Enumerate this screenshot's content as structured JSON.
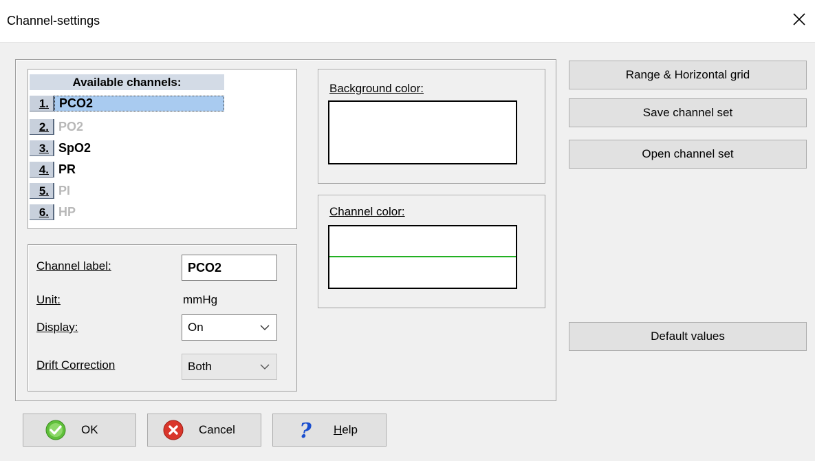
{
  "window": {
    "title": "Channel-settings"
  },
  "channels": {
    "header": "Available channels:",
    "items": [
      {
        "num": "1.",
        "name": "PCO2",
        "state": "selected"
      },
      {
        "num": "2.",
        "name": "PO2",
        "state": "disabled"
      },
      {
        "num": "3.",
        "name": "SpO2",
        "state": "enabled"
      },
      {
        "num": "4.",
        "name": "PR",
        "state": "enabled"
      },
      {
        "num": "5.",
        "name": "PI",
        "state": "disabled"
      },
      {
        "num": "6.",
        "name": "HP",
        "state": "disabled"
      }
    ]
  },
  "properties": {
    "channel_label_label": "Channel label:",
    "channel_label_value": "PCO2",
    "unit_label": "Unit:",
    "unit_value": "mmHg",
    "display_label": "Display:",
    "display_value": "On",
    "drift_label": "Drift Correction",
    "drift_value": "Both"
  },
  "colors": {
    "background_label": "Background color:",
    "channel_label": "Channel color:",
    "background_color": "#ffffff",
    "channel_line_color": "#22b022"
  },
  "side_buttons": {
    "range": "Range & Horizontal grid",
    "save": "Save channel set",
    "open": "Open channel set",
    "defaults": "Default values"
  },
  "bottom_buttons": {
    "ok": "OK",
    "cancel": "Cancel",
    "help_first": "H",
    "help_rest": "elp"
  },
  "icons": {
    "close": "close-icon",
    "ok": "check-circle-icon",
    "cancel": "x-circle-icon",
    "help": "question-mark-icon"
  }
}
